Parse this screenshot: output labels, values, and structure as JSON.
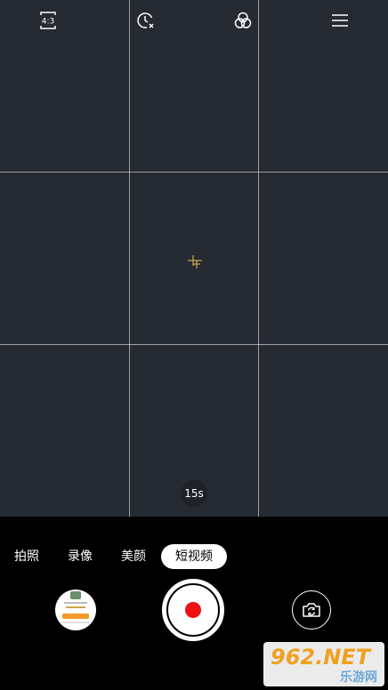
{
  "topbar": {
    "ratio_label": "4:3",
    "icons": [
      "aspect-ratio-icon",
      "timer-icon",
      "filter-icon",
      "menu-icon"
    ]
  },
  "viewfinder": {
    "duration_label": "15s",
    "focus_color": "#e8c25a"
  },
  "modes": [
    {
      "label": "拍照",
      "active": false
    },
    {
      "label": "录像",
      "active": false
    },
    {
      "label": "美颜",
      "active": false
    },
    {
      "label": "短视频",
      "active": true
    }
  ],
  "controls": {
    "record_color": "#ee1111"
  },
  "watermark": {
    "main": "962.NET",
    "sub": "乐游网"
  }
}
